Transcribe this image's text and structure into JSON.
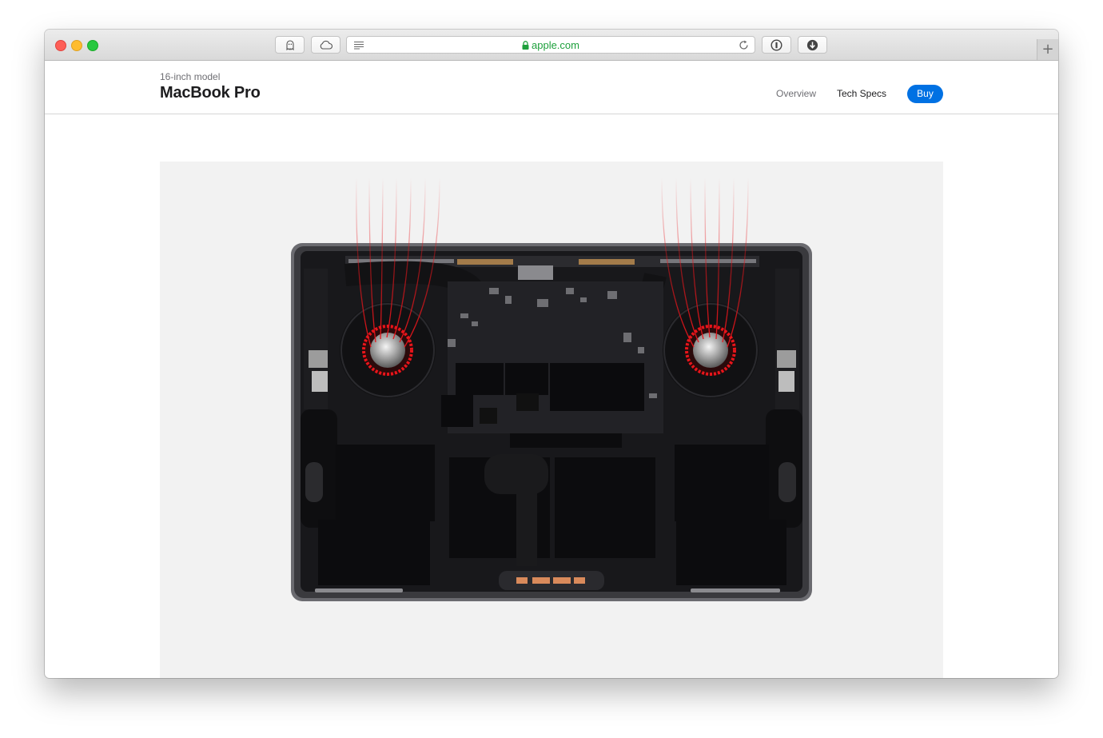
{
  "browser": {
    "address": "apple.com",
    "icons": {
      "ghostery": "ghost-icon",
      "icloud": "cloud-icon",
      "reader": "reader-view-icon",
      "lock": "lock-icon",
      "reload": "reload-icon",
      "onepassword": "password-manager-icon",
      "downloads": "download-icon",
      "new_tab": "plus-icon"
    },
    "new_tab_label": "+"
  },
  "localnav": {
    "eyebrow": "16-inch model",
    "title": "MacBook Pro",
    "links": [
      "Overview",
      "Tech Specs"
    ],
    "buy_label": "Buy"
  },
  "hero": {
    "image": "macbook-pro-internals-with-fan-airflow",
    "accent_airflow": "#e8151b"
  }
}
